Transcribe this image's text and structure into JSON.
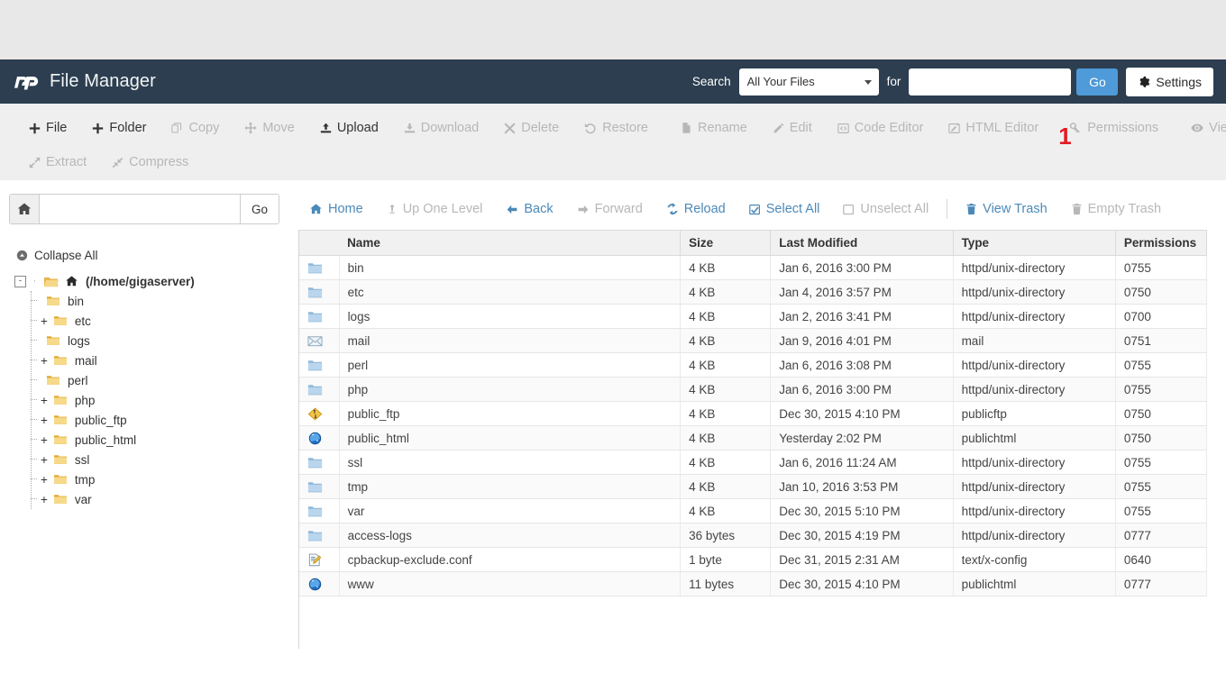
{
  "header": {
    "brand_title": "File Manager",
    "logo_icon": "cpanel-logo-icon",
    "search_label": "Search",
    "search_scope_value": "All Your Files",
    "search_for_label": "for",
    "search_query_value": "",
    "search_query_placeholder": "",
    "go_label": "Go",
    "settings_label": "Settings",
    "settings_icon": "gear-icon",
    "bg_color": "#2c3e50",
    "accent_color": "#4f9ad8"
  },
  "toolbar": {
    "row1": [
      {
        "label": "File",
        "icon": "plus-icon",
        "enabled": true
      },
      {
        "label": "Folder",
        "icon": "plus-icon",
        "enabled": true
      },
      {
        "label": "Copy",
        "icon": "copy-icon",
        "enabled": false
      },
      {
        "label": "Move",
        "icon": "move-arrows-icon",
        "enabled": false
      },
      {
        "label": "Upload",
        "icon": "upload-icon",
        "enabled": true
      },
      {
        "label": "Download",
        "icon": "download-icon",
        "enabled": false
      },
      {
        "label": "Delete",
        "icon": "x-delete-icon",
        "enabled": false
      },
      {
        "label": "Restore",
        "icon": "restore-undo-icon",
        "enabled": false
      },
      {
        "label": "Rename",
        "icon": "file-rename-icon",
        "enabled": false
      },
      {
        "label": "Edit",
        "icon": "pencil-icon",
        "enabled": false
      },
      {
        "label": "Code Editor",
        "icon": "code-editor-icon",
        "enabled": false
      },
      {
        "label": "HTML Editor",
        "icon": "html-editor-icon",
        "enabled": false
      },
      {
        "label": "Permissions",
        "icon": "key-icon",
        "enabled": false,
        "marker": "1"
      },
      {
        "label": "View",
        "icon": "eye-icon",
        "enabled": false
      }
    ],
    "row2": [
      {
        "label": "Extract",
        "icon": "extract-icon",
        "enabled": false
      },
      {
        "label": "Compress",
        "icon": "compress-icon",
        "enabled": false
      }
    ],
    "marker_color": "#e31b23"
  },
  "navbar": {
    "home_icon": "home-icon",
    "path_value": "",
    "path_placeholder": "",
    "go_label": "Go",
    "actions": [
      {
        "label": "Home",
        "icon": "home-icon",
        "enabled": true
      },
      {
        "label": "Up One Level",
        "icon": "up-level-icon",
        "enabled": false
      },
      {
        "label": "Back",
        "icon": "arrow-left-icon",
        "enabled": true
      },
      {
        "label": "Forward",
        "icon": "arrow-right-icon",
        "enabled": false
      },
      {
        "label": "Reload",
        "icon": "reload-icon",
        "enabled": true
      },
      {
        "label": "Select All",
        "icon": "checkbox-checked-icon",
        "enabled": true
      },
      {
        "label": "Unselect All",
        "icon": "checkbox-empty-icon",
        "enabled": false
      },
      {
        "label": "View Trash",
        "icon": "trash-icon",
        "enabled": true
      },
      {
        "label": "Empty Trash",
        "icon": "trash-icon",
        "enabled": false
      }
    ]
  },
  "sidebar": {
    "collapse_all_label": "Collapse All",
    "collapse_all_icon": "collapse-circle-icon",
    "root": {
      "label": "(/home/gigaserver)",
      "icon": "home-folder-open-icon",
      "expander": "-"
    },
    "items": [
      {
        "label": "bin",
        "icon": "folder-icon",
        "expander": ""
      },
      {
        "label": "etc",
        "icon": "folder-icon",
        "expander": "+"
      },
      {
        "label": "logs",
        "icon": "folder-icon",
        "expander": ""
      },
      {
        "label": "mail",
        "icon": "folder-icon",
        "expander": "+"
      },
      {
        "label": "perl",
        "icon": "folder-icon",
        "expander": ""
      },
      {
        "label": "php",
        "icon": "folder-icon",
        "expander": "+"
      },
      {
        "label": "public_ftp",
        "icon": "folder-icon",
        "expander": "+"
      },
      {
        "label": "public_html",
        "icon": "folder-icon",
        "expander": "+"
      },
      {
        "label": "ssl",
        "icon": "folder-icon",
        "expander": "+"
      },
      {
        "label": "tmp",
        "icon": "folder-icon",
        "expander": "+"
      },
      {
        "label": "var",
        "icon": "folder-icon",
        "expander": "+"
      }
    ]
  },
  "filetable": {
    "columns": [
      "Name",
      "Size",
      "Last Modified",
      "Type",
      "Permissions"
    ],
    "rows": [
      {
        "icon": "folder-blue-icon",
        "name": "bin",
        "size": "4 KB",
        "modified": "Jan 6, 2016 3:00 PM",
        "type": "httpd/unix-directory",
        "permissions": "0755"
      },
      {
        "icon": "folder-blue-icon",
        "name": "etc",
        "size": "4 KB",
        "modified": "Jan 4, 2016 3:57 PM",
        "type": "httpd/unix-directory",
        "permissions": "0750"
      },
      {
        "icon": "folder-blue-icon",
        "name": "logs",
        "size": "4 KB",
        "modified": "Jan 2, 2016 3:41 PM",
        "type": "httpd/unix-directory",
        "permissions": "0700"
      },
      {
        "icon": "envelope-mail-icon",
        "name": "mail",
        "size": "4 KB",
        "modified": "Jan 9, 2016 4:01 PM",
        "type": "mail",
        "permissions": "0751"
      },
      {
        "icon": "folder-blue-icon",
        "name": "perl",
        "size": "4 KB",
        "modified": "Jan 6, 2016 3:08 PM",
        "type": "httpd/unix-directory",
        "permissions": "0755"
      },
      {
        "icon": "folder-blue-icon",
        "name": "php",
        "size": "4 KB",
        "modified": "Jan 6, 2016 3:00 PM",
        "type": "httpd/unix-directory",
        "permissions": "0755"
      },
      {
        "icon": "ftp-diamond-icon",
        "name": "public_ftp",
        "size": "4 KB",
        "modified": "Dec 30, 2015 4:10 PM",
        "type": "publicftp",
        "permissions": "0750"
      },
      {
        "icon": "globe-icon",
        "name": "public_html",
        "size": "4 KB",
        "modified": "Yesterday 2:02 PM",
        "type": "publichtml",
        "permissions": "0750"
      },
      {
        "icon": "folder-blue-icon",
        "name": "ssl",
        "size": "4 KB",
        "modified": "Jan 6, 2016 11:24 AM",
        "type": "httpd/unix-directory",
        "permissions": "0755"
      },
      {
        "icon": "folder-blue-icon",
        "name": "tmp",
        "size": "4 KB",
        "modified": "Jan 10, 2016 3:53 PM",
        "type": "httpd/unix-directory",
        "permissions": "0755"
      },
      {
        "icon": "folder-blue-icon",
        "name": "var",
        "size": "4 KB",
        "modified": "Dec 30, 2015 5:10 PM",
        "type": "httpd/unix-directory",
        "permissions": "0755"
      },
      {
        "icon": "folder-blue-icon",
        "name": "access-logs",
        "size": "36 bytes",
        "modified": "Dec 30, 2015 4:19 PM",
        "type": "httpd/unix-directory",
        "permissions": "0777"
      },
      {
        "icon": "config-file-icon",
        "name": "cpbackup-exclude.conf",
        "size": "1 byte",
        "modified": "Dec 31, 2015 2:31 AM",
        "type": "text/x-config",
        "permissions": "0640"
      },
      {
        "icon": "globe-icon",
        "name": "www",
        "size": "11 bytes",
        "modified": "Dec 30, 2015 4:10 PM",
        "type": "publichtml",
        "permissions": "0777"
      }
    ]
  }
}
